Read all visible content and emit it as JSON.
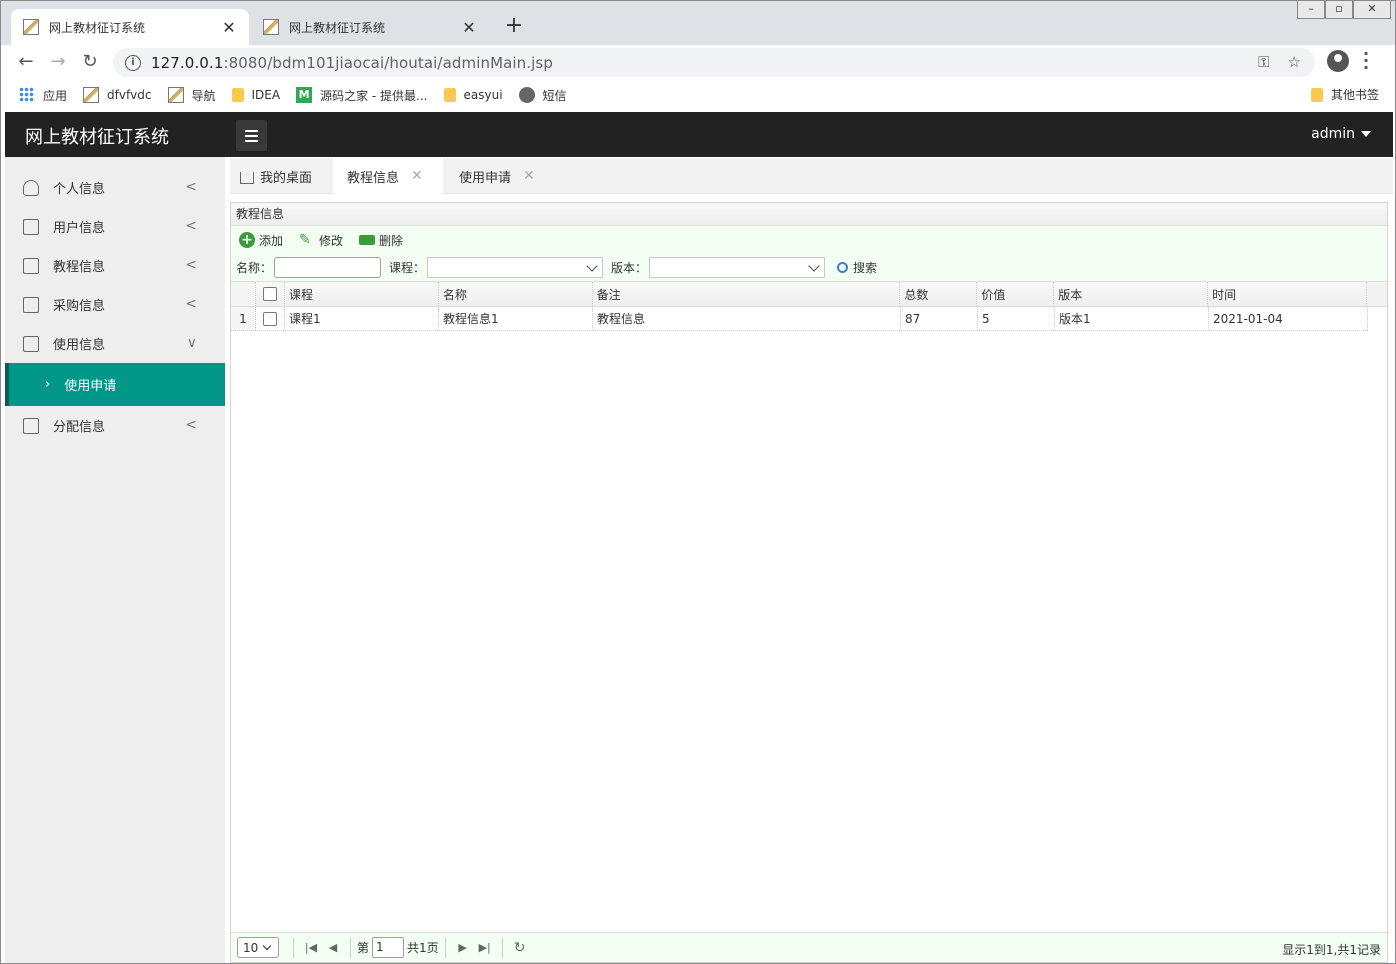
{
  "browser": {
    "tabs": [
      {
        "title": "网上教材征订系统",
        "active": true
      },
      {
        "title": "网上教材征订系统",
        "active": false
      }
    ],
    "url_host": "127.0.0.1",
    "url_port_path": ":8080/bdm101jiaocai/houtai/adminMain.jsp",
    "bookmarks": [
      "应用",
      "dfvfvdc",
      "导航",
      "IDEA",
      "源码之家 - 提供最...",
      "easyui",
      "短信"
    ],
    "other_bookmarks": "其他书签"
  },
  "app": {
    "title": "网上教材征订系统",
    "user": "admin"
  },
  "sidebar": {
    "items": [
      {
        "label": "个人信息",
        "icon": "user-icon",
        "arrow": "<"
      },
      {
        "label": "用户信息",
        "icon": "document-icon",
        "arrow": "<"
      },
      {
        "label": "教程信息",
        "icon": "document-icon",
        "arrow": "<"
      },
      {
        "label": "采购信息",
        "icon": "document-icon",
        "arrow": "<"
      },
      {
        "label": "使用信息",
        "icon": "document-icon",
        "arrow": "∨"
      },
      {
        "label": "分配信息",
        "icon": "document-icon",
        "arrow": "<"
      }
    ],
    "active_sub": "使用申请",
    "accent_color": "#009688"
  },
  "page_tabs": [
    {
      "label": "我的桌面",
      "closable": false
    },
    {
      "label": "教程信息",
      "closable": true,
      "active": true
    },
    {
      "label": "使用申请",
      "closable": true
    }
  ],
  "panel": {
    "title": "教程信息",
    "actions": [
      "添加",
      "修改",
      "删除"
    ],
    "search": {
      "name_label": "名称：",
      "course_label": "课程：",
      "version_label": "版本：",
      "button": "搜索"
    },
    "columns": [
      "课程",
      "名称",
      "备注",
      "总数",
      "价值",
      "版本",
      "时间"
    ],
    "rows": [
      {
        "num": "1",
        "course": "课程1",
        "name": "教程信息1",
        "note": "教程信息",
        "total": "87",
        "price": "5",
        "version": "版本1",
        "time": "2021-01-04"
      }
    ],
    "pager": {
      "page_size": "10",
      "page_prefix": "第",
      "page_value": "1",
      "page_total": "共1页",
      "info": "显示1到1,共1记录"
    }
  }
}
